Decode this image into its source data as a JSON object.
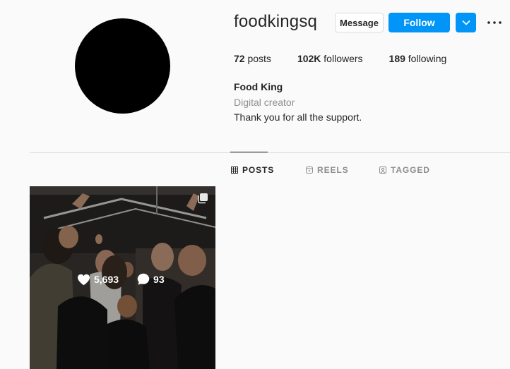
{
  "profile": {
    "username": "foodkingsq",
    "message_label": "Message",
    "follow_label": "Follow",
    "stats": {
      "posts_count": "72",
      "posts_label": "posts",
      "followers_count": "102K",
      "followers_label": "followers",
      "following_count": "189",
      "following_label": "following"
    },
    "bio": {
      "name": "Food King",
      "category": "Digital creator",
      "text": "Thank you for all the support."
    }
  },
  "tabs": [
    {
      "label": "POSTS",
      "icon": "grid-icon",
      "active": true
    },
    {
      "label": "REELS",
      "icon": "reels-icon",
      "active": false
    },
    {
      "label": "TAGGED",
      "icon": "tagged-icon",
      "active": false
    }
  ],
  "posts": [
    {
      "likes": "5,693",
      "comments": "93",
      "multiple": true
    }
  ],
  "colors": {
    "accent": "#0095f6",
    "background": "#fafafa",
    "text": "#262626",
    "muted": "#8e8e8e"
  }
}
